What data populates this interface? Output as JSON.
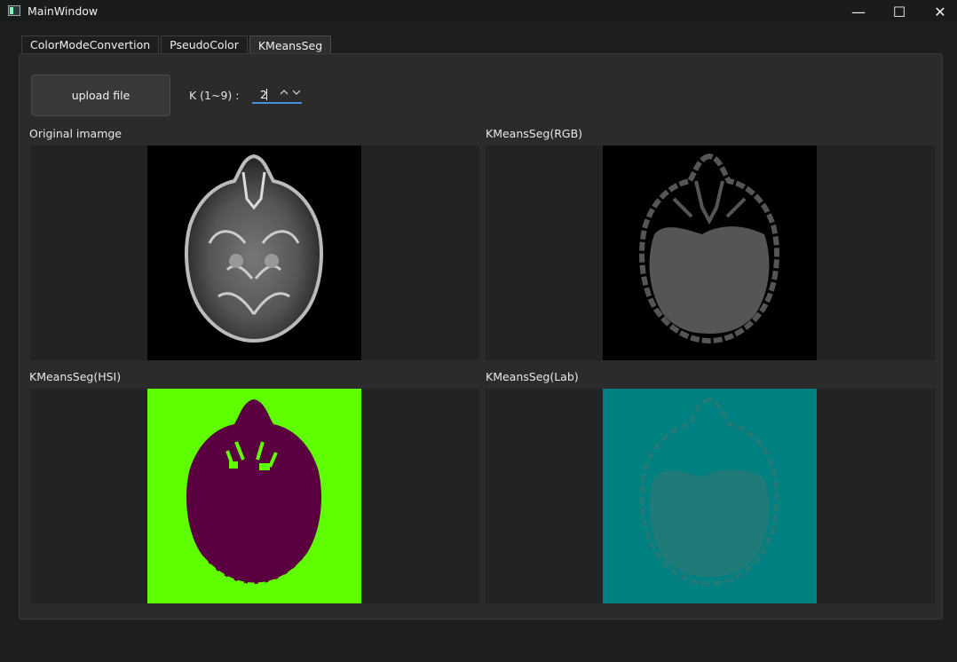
{
  "window": {
    "title": "MainWindow",
    "controls": [
      "—",
      "☐",
      "✕"
    ]
  },
  "tabs": [
    "ColorModeConvertion",
    "PseudoColor",
    "KMeansSeg"
  ],
  "active_tab": "KMeansSeg",
  "toolbar": {
    "upload_label": "upload file",
    "k_label": "K (1~9) :",
    "k_value": "2",
    "up_arrow": "^",
    "down_arrow": "v"
  },
  "views": {
    "original": {
      "caption": "Original imamge"
    },
    "rgb": {
      "caption": "KMeansSeg(RGB)"
    },
    "hsi": {
      "caption": "KMeansSeg(HSI)"
    },
    "lab": {
      "caption": "KMeansSeg(Lab)"
    }
  },
  "colors": {
    "hsi_background": "#5fff00",
    "hsi_foreground": "#5a0040",
    "lab_background": "#008080",
    "lab_foreground": "#1f7a78",
    "rgb_foreground": "#555555",
    "accent": "#4a90d9"
  }
}
